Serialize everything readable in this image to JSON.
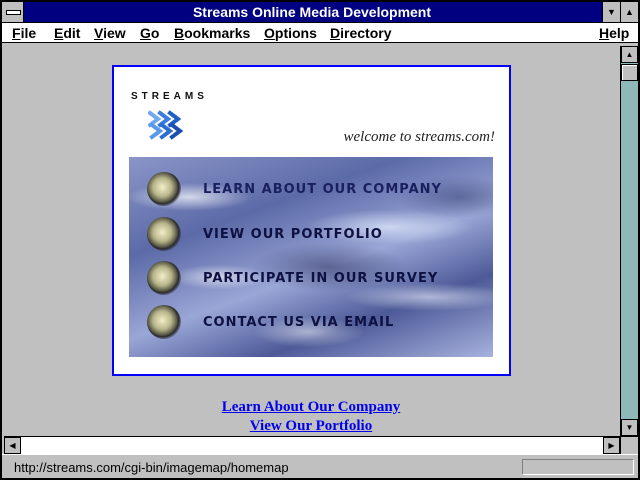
{
  "window": {
    "title": "Streams Online Media Development"
  },
  "menu": {
    "file": "File",
    "edit": "Edit",
    "view": "View",
    "go": "Go",
    "bookmarks": "Bookmarks",
    "options": "Options",
    "directory": "Directory",
    "help": "Help"
  },
  "page": {
    "brand": "STREAMS",
    "welcome": "welcome to streams.com!",
    "map_links": [
      {
        "label": "LEARN ABOUT OUR COMPANY"
      },
      {
        "label": "VIEW OUR PORTFOLIO"
      },
      {
        "label": "PARTICIPATE IN OUR SURVEY"
      },
      {
        "label": "CONTACT US VIA EMAIL"
      }
    ],
    "text_links": [
      "Learn About Our Company",
      "View Our Portfolio"
    ]
  },
  "status": {
    "url": "http://streams.com/cgi-bin/imagemap/homemap"
  },
  "colors": {
    "titlebar": "#000080",
    "link": "#0000ee",
    "imagemap_border": "#0000ff",
    "scroll_track": "#8fb8b8"
  },
  "icons": {
    "sysmenu": "system-menu-icon",
    "minimize": "minimize-icon",
    "maximize": "maximize-icon",
    "scroll_up": "arrow-up-icon",
    "scroll_down": "arrow-down-icon",
    "scroll_left": "arrow-left-icon",
    "scroll_right": "arrow-right-icon",
    "logo": "streams-chevrons-icon"
  }
}
